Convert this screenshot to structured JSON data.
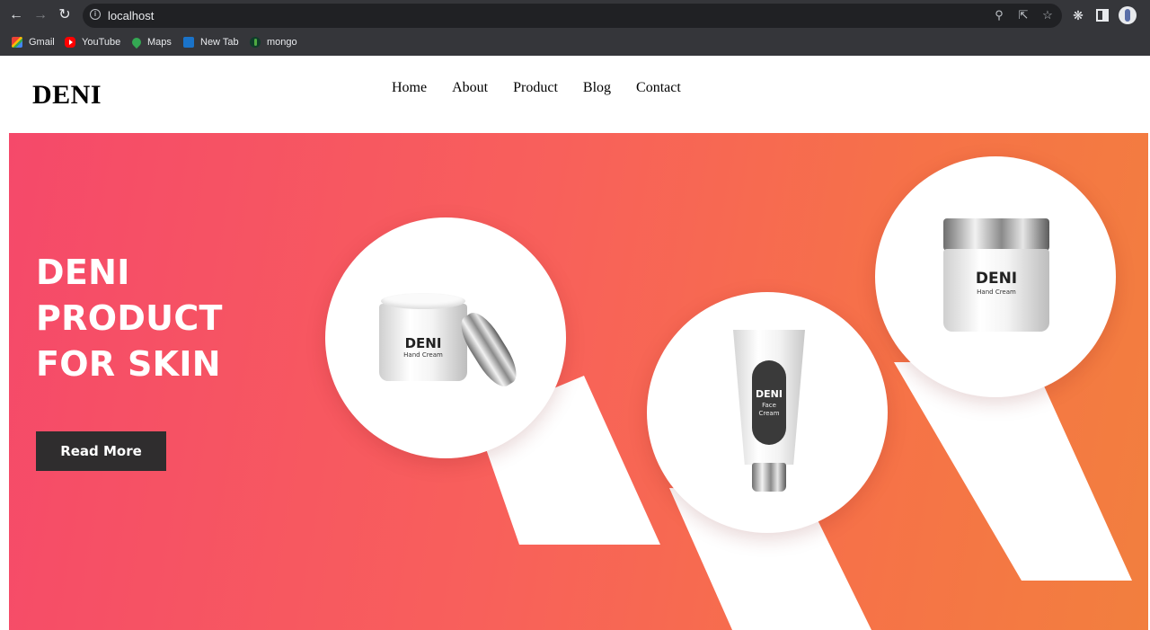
{
  "browser": {
    "url": "localhost",
    "bookmarks": [
      {
        "label": "Gmail",
        "icon": "gmail-icon"
      },
      {
        "label": "YouTube",
        "icon": "youtube-icon"
      },
      {
        "label": "Maps",
        "icon": "maps-icon"
      },
      {
        "label": "New Tab",
        "icon": "newtab-icon"
      },
      {
        "label": "mongo",
        "icon": "mongodb-icon"
      }
    ]
  },
  "site": {
    "logo": "DENI",
    "nav": [
      "Home",
      "About",
      "Product",
      "Blog",
      "Contact"
    ]
  },
  "hero": {
    "title_lines": [
      "DENI",
      "PRODUCT",
      "FOR SKIN"
    ],
    "button_label": "Read More",
    "gradient_colors": [
      "#f5496a",
      "#f27f3e"
    ],
    "products": [
      {
        "brand": "DENI",
        "name": "Hand Cream"
      },
      {
        "brand": "DENI",
        "name_lines": [
          "Face",
          "Cream"
        ]
      },
      {
        "brand": "DENI",
        "name": "Hand Cream"
      }
    ]
  }
}
